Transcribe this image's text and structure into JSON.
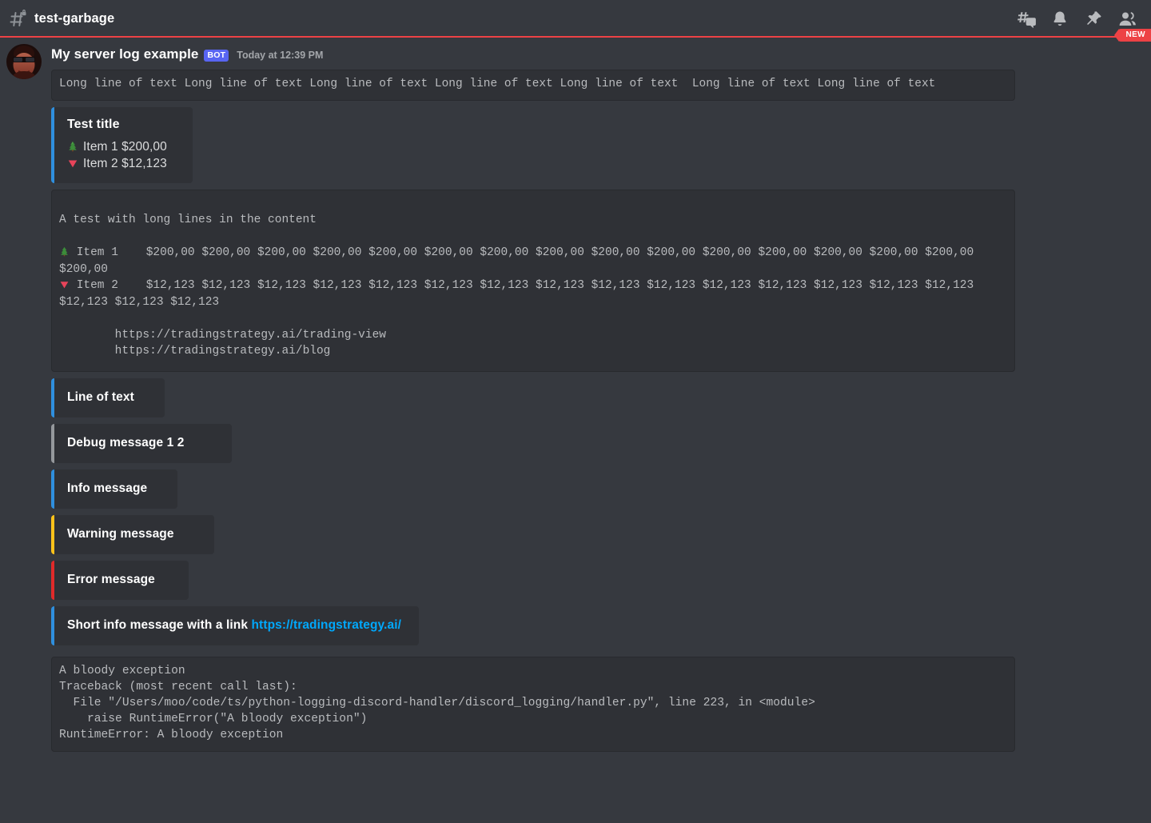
{
  "header": {
    "channel_name": "test-garbage",
    "channel_icon": "hash-lock-icon",
    "icons": [
      {
        "name": "threads-icon",
        "label": "Threads"
      },
      {
        "name": "bell-icon",
        "label": "Notification Settings"
      },
      {
        "name": "pin-icon",
        "label": "Pinned Messages"
      },
      {
        "name": "members-icon",
        "label": "Member List"
      }
    ],
    "new_badge": "NEW"
  },
  "message": {
    "author": "My server log example",
    "bot_tag": "BOT",
    "timestamp": "Today at 12:39 PM",
    "avatar_name": "user-avatar"
  },
  "code_block_1": "Long line of text Long line of text Long line of text Long line of text Long line of text  Long line of text Long line of text",
  "embed_test": {
    "bar_color": "#2f8fde",
    "title": "Test title",
    "rows": [
      {
        "emoji": "evergreen-tree",
        "text": "Item 1 $200,00"
      },
      {
        "emoji": "red-triangle-down",
        "text": "Item 2 $12,123"
      }
    ]
  },
  "code_block_2": {
    "header": "A test with long lines in the content",
    "item1_emoji": "evergreen-tree",
    "item1": " Item 1    $200,00 $200,00 $200,00 $200,00 $200,00 $200,00 $200,00 $200,00 $200,00 $200,00 $200,00 $200,00 $200,00 $200,00 $200,00 $200,00",
    "item2_emoji": "red-triangle-down",
    "item2": " Item 2    $12,123 $12,123 $12,123 $12,123 $12,123 $12,123 $12,123 $12,123 $12,123 $12,123 $12,123 $12,123 $12,123 $12,123 $12,123 $12,123 $12,123 $12,123",
    "links": "        https://tradingstrategy.ai/trading-view\n        https://tradingstrategy.ai/blog"
  },
  "log_embeds": [
    {
      "name": "line-of-text",
      "text": "Line of text",
      "bar_color": "#2f8fde"
    },
    {
      "name": "debug-message",
      "text": "Debug message 1 2",
      "bar_color": "#95989c"
    },
    {
      "name": "info-message",
      "text": "Info message",
      "bar_color": "#2f8fde"
    },
    {
      "name": "warning-message",
      "text": "Warning message",
      "bar_color": "#fcc21b"
    },
    {
      "name": "error-message",
      "text": "Error message",
      "bar_color": "#e02a2a"
    }
  ],
  "link_embed": {
    "bar_color": "#2f8fde",
    "prefix": "Short info message with a link ",
    "link_text": "https://tradingstrategy.ai/"
  },
  "code_block_3": "A bloody exception\nTraceback (most recent call last):\n  File \"/Users/moo/code/ts/python-logging-discord-handler/discord_logging/handler.py\", line 223, in <module>\n    raise RuntimeError(\"A bloody exception\")\nRuntimeError: A bloody exception",
  "colors": {
    "page_bg": "#36393f",
    "surface_bg": "#2f3136",
    "accent_blue": "#2f8fde",
    "link_blue": "#00a8fc",
    "bot_blurple": "#5865f2",
    "unread_red": "#ed4245"
  }
}
